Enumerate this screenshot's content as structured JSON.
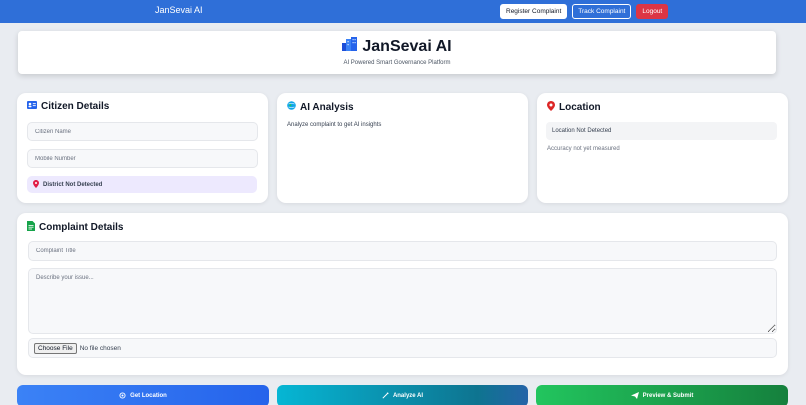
{
  "navbar": {
    "brand": "JanSevai AI",
    "register_label": "Register Complaint",
    "track_label": "Track Complaint",
    "logout_label": "Logout"
  },
  "header": {
    "title": "JanSevai AI",
    "subtitle": "AI Powered Smart Governance Platform"
  },
  "citizen": {
    "title": "Citizen Details",
    "name_placeholder": "Citizen Name",
    "mobile_placeholder": "Mobile Number",
    "district_status": "District Not Detected"
  },
  "analysis": {
    "title": "AI Analysis",
    "message": "Analyze complaint to get AI insights"
  },
  "location": {
    "title": "Location",
    "status": "Location Not Detected",
    "accuracy": "Accuracy not yet measured"
  },
  "complaint": {
    "title": "Complaint Details",
    "title_placeholder": "Complaint Title",
    "description_placeholder": "Describe your issue...",
    "file_button": "Choose File",
    "file_status": "No file chosen"
  },
  "actions": {
    "get_location": "Get Location",
    "analyze": "Analyze AI",
    "submit": "Preview & Submit"
  },
  "colors": {
    "navbar": "#2f6fd8",
    "logout": "#dc3545",
    "location_button": "#3b82f6",
    "analyze_button": "#06b6d4",
    "submit_button": "#22c55e"
  }
}
